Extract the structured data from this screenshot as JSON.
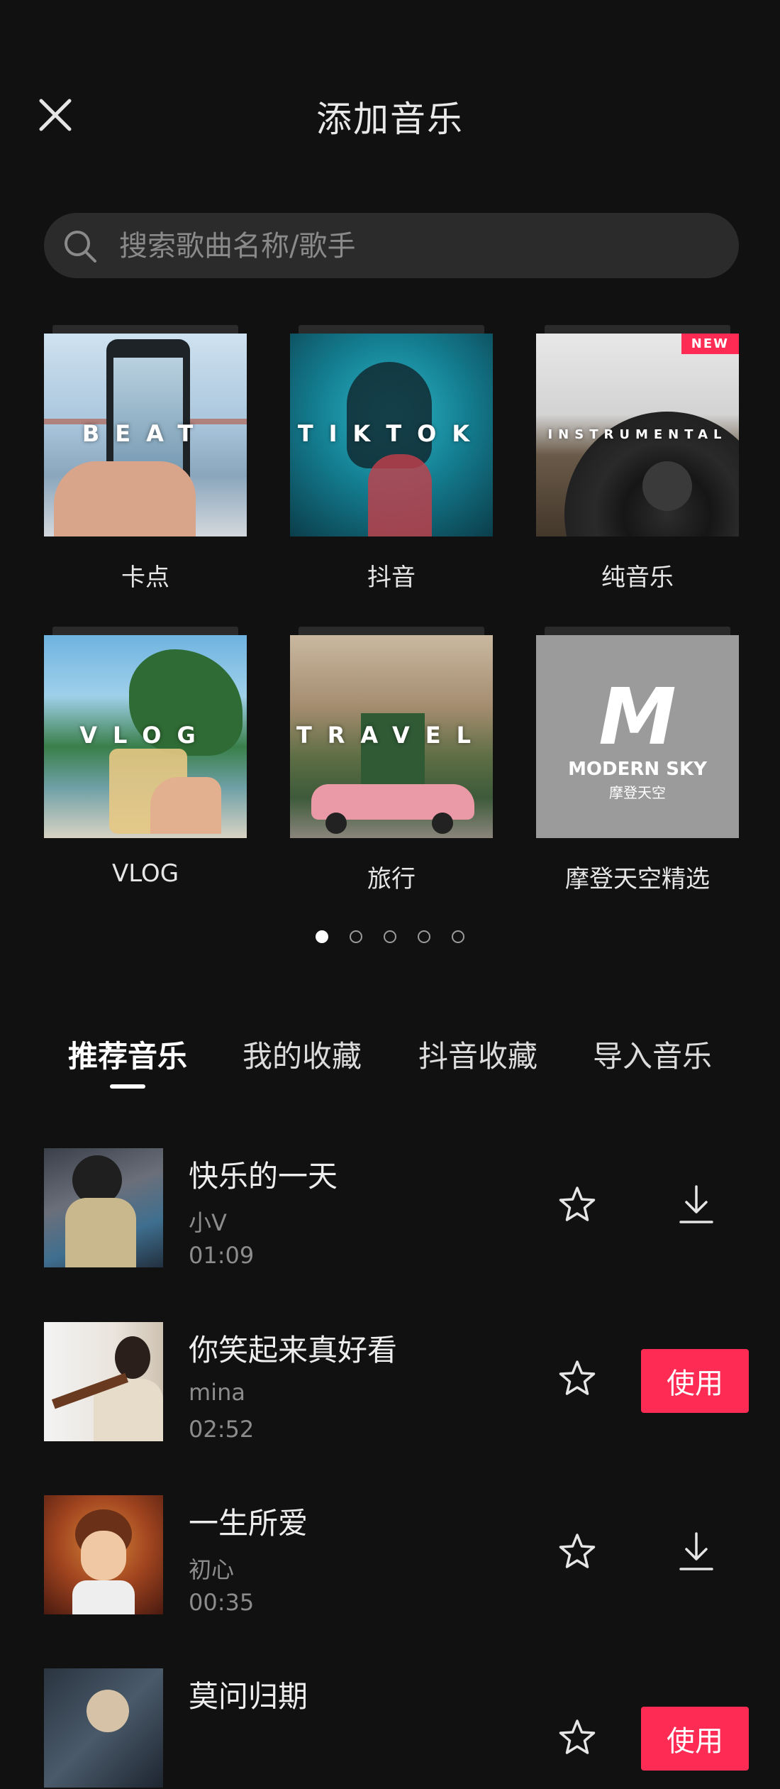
{
  "header": {
    "title": "添加音乐",
    "close_icon": "close-icon"
  },
  "search": {
    "placeholder": "搜索歌曲名称/歌手",
    "icon": "search-icon"
  },
  "categories": [
    {
      "label": "卡点",
      "overlay": "BEAT"
    },
    {
      "label": "抖音",
      "overlay": "TIKTOK"
    },
    {
      "label": "纯音乐",
      "overlay": "INSTRUMENTAL",
      "badge": "NEW"
    },
    {
      "label": "VLOG",
      "overlay": "VLOG"
    },
    {
      "label": "旅行",
      "overlay": "TRAVEL"
    },
    {
      "label": "摩登天空精选",
      "logo_text": "MODERN SKY",
      "logo_sub": "摩登天空"
    }
  ],
  "pagination": {
    "pages": 5,
    "current": 1
  },
  "tabs": [
    {
      "label": "推荐音乐",
      "active": true
    },
    {
      "label": "我的收藏"
    },
    {
      "label": "抖音收藏"
    },
    {
      "label": "导入音乐"
    }
  ],
  "songs": [
    {
      "title": "快乐的一天",
      "artist": "小V",
      "duration": "01:09",
      "action": "download"
    },
    {
      "title": "你笑起来真好看",
      "artist": "mina",
      "duration": "02:52",
      "action": "use",
      "use_label": "使用"
    },
    {
      "title": "一生所爱",
      "artist": "初心",
      "duration": "00:35",
      "action": "download"
    },
    {
      "title": "莫问归期",
      "action": "use",
      "use_label": "使用"
    }
  ],
  "colors": {
    "background": "#111111",
    "accent": "#fe2c55",
    "search_bg": "#2b2b2b"
  }
}
